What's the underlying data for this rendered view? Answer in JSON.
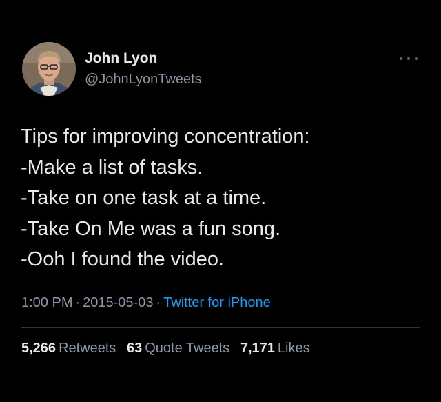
{
  "author": {
    "display_name": "John Lyon",
    "handle": "@JohnLyonTweets",
    "avatar_icon": "profile-photo-icon"
  },
  "more_icon": "more-options-icon",
  "tweet": {
    "lines": [
      "Tips for improving concentration:",
      "-Make a list of tasks.",
      "-Take on one task at a time.",
      "-Take On Me was a fun song.",
      "-Ooh I found the video."
    ]
  },
  "meta": {
    "time": "1:00 PM",
    "separator": "·",
    "date": "2015-05-03",
    "source": "Twitter for iPhone"
  },
  "stats": {
    "retweets_count": "5,266",
    "retweets_label": "Retweets",
    "quotes_count": "63",
    "quotes_label": "Quote Tweets",
    "likes_count": "7,171",
    "likes_label": "Likes"
  },
  "colors": {
    "background": "#000000",
    "primary_text": "#e7e9ea",
    "secondary_text": "#8b98a5",
    "link": "#1d9bf0",
    "divider": "#2f3336"
  }
}
